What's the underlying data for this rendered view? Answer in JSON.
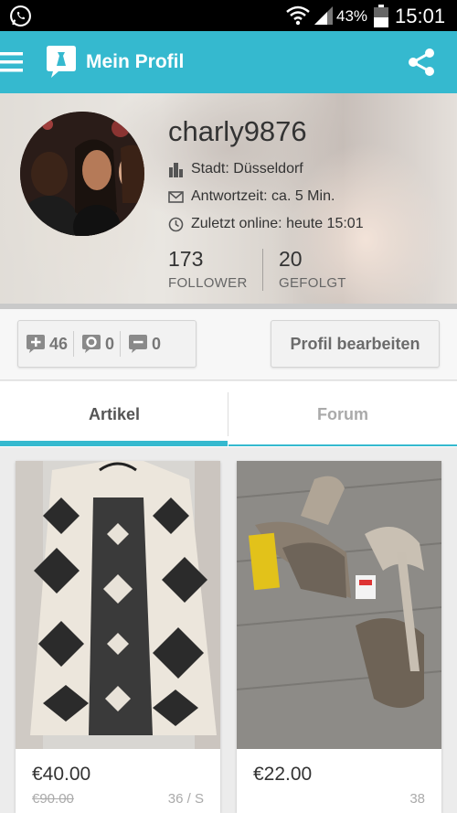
{
  "status_bar": {
    "battery_percent": "43%",
    "time": "15:01"
  },
  "app_bar": {
    "title": "Mein Profil"
  },
  "profile": {
    "username": "charly9876",
    "city_label": "Stadt:",
    "city_value": "Düsseldorf",
    "reply_label": "Antwortzeit:",
    "reply_value": "ca. 5 Min.",
    "online_label": "Zuletzt online:",
    "online_value": "heute 15:01",
    "followers_count": "173",
    "followers_label": "FOLLOWER",
    "following_count": "20",
    "following_label": "GEFOLGT"
  },
  "counters": {
    "positive": "46",
    "neutral": "0",
    "negative": "0"
  },
  "edit_button_label": "Profil bearbeiten",
  "tabs": [
    {
      "label": "Artikel",
      "active": true
    },
    {
      "label": "Forum",
      "active": false
    }
  ],
  "items": [
    {
      "price": "€40.00",
      "old_price": "€90.00",
      "size": "36 / S"
    },
    {
      "price": "€22.00",
      "old_price": "",
      "size": "38"
    }
  ],
  "colors": {
    "accent": "#35b9cf",
    "status_bar": "#000000"
  },
  "icons": [
    "whatsapp-icon",
    "wifi-icon",
    "signal-icon",
    "battery-icon",
    "menu-icon",
    "app-logo-icon",
    "share-icon",
    "city-icon",
    "mail-icon",
    "clock-icon",
    "plus-bubble-icon",
    "neutral-bubble-icon",
    "minus-bubble-icon"
  ]
}
